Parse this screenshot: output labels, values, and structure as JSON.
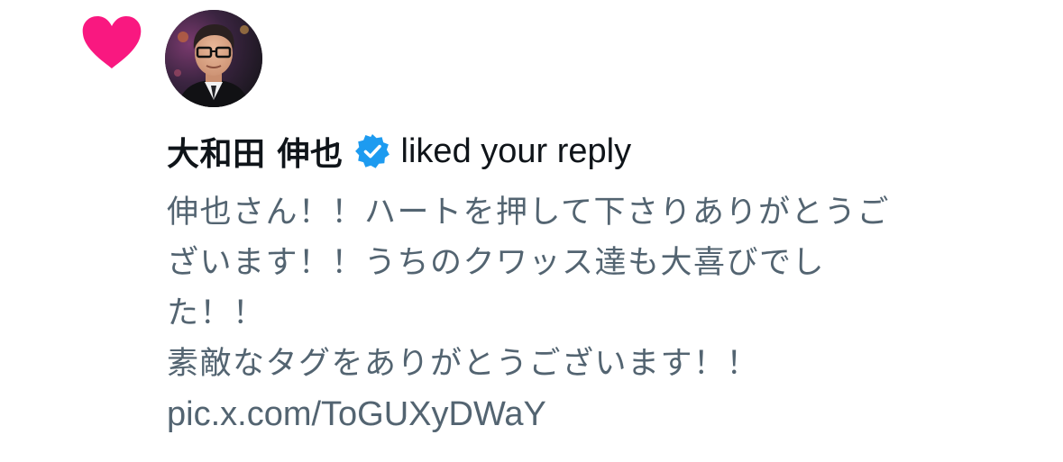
{
  "notification": {
    "icon": "heart-icon",
    "icon_color": "#f91880",
    "avatar_icon": "avatar",
    "user_name": "大和田 伸也",
    "verified_icon": "verified-badge-icon",
    "verified_color": "#1d9bf0",
    "action_text": "liked your reply",
    "reply_lines": [
      "伸也さん！！ハートを押して下さりありがとうご",
      "ざいます！！うちのクワッス達も大喜びでし",
      "た！！",
      "素敵なタグをありがとうございます！！"
    ],
    "reply_link": "pic.x.com/ToGUXyDWaY"
  },
  "colors": {
    "primary_text": "#0f1419",
    "secondary_text": "#536471",
    "like": "#f91880",
    "verified": "#1d9bf0"
  }
}
